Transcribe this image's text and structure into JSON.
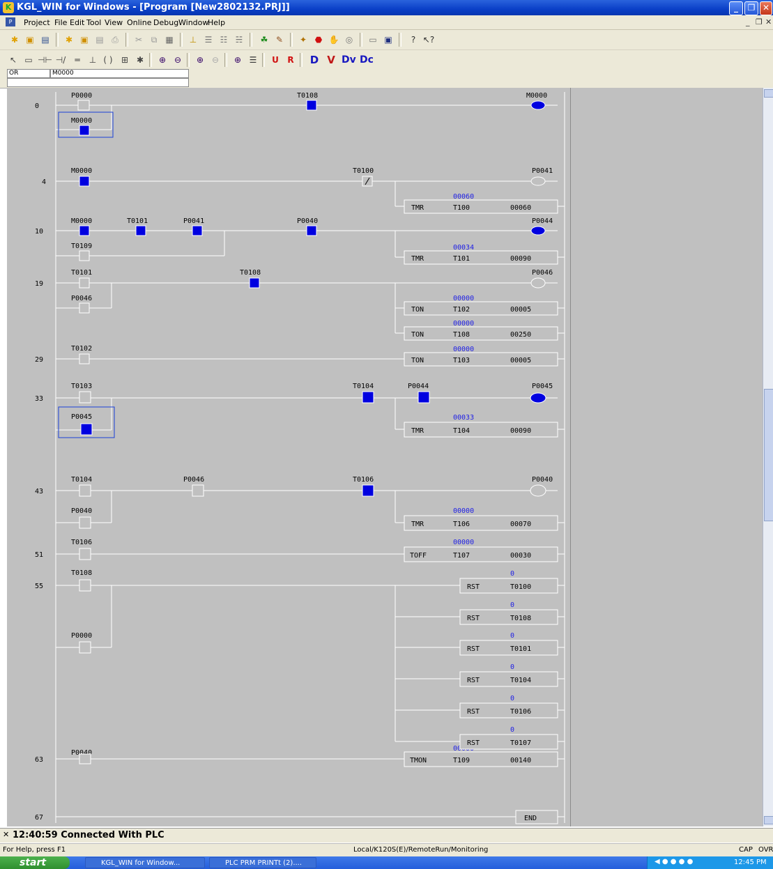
{
  "window": {
    "title": "KGL_WIN for Windows - [Program [New2802132.PRJ]]"
  },
  "menu": [
    "Project",
    "File",
    "Edit",
    "Tool",
    "View",
    "Online",
    "Debug",
    "Window",
    "Help"
  ],
  "input": {
    "mode": "OR",
    "operand": "M0000"
  },
  "ladder": {
    "steps": [
      "0",
      "4",
      "10",
      "19",
      "29",
      "33",
      "43",
      "51",
      "55",
      "63",
      "67"
    ],
    "contacts": [
      "P0000",
      "T0108",
      "M0000",
      "M0000",
      "T0100",
      "M0000",
      "T0101",
      "P0041",
      "P0040",
      "T0109",
      "T0101",
      "T0108",
      "P0046",
      "T0102",
      "T0103",
      "T0104",
      "P0044",
      "P0045",
      "T0104",
      "P0046",
      "T0106",
      "P0040",
      "T0106",
      "T0108",
      "P0000",
      "P0040"
    ],
    "coils": [
      "M0000",
      "P0041",
      "P0044",
      "P0046",
      "P0045",
      "P0040"
    ],
    "function_blocks": [
      {
        "op": "TMR",
        "timer": "T100",
        "preset": "00060",
        "current": "00060"
      },
      {
        "op": "TMR",
        "timer": "T101",
        "preset": "00090",
        "current": "00034"
      },
      {
        "op": "TON",
        "timer": "T102",
        "preset": "00005",
        "current": "00000"
      },
      {
        "op": "TON",
        "timer": "T108",
        "preset": "00250",
        "current": "00000"
      },
      {
        "op": "TON",
        "timer": "T103",
        "preset": "00005",
        "current": "00000"
      },
      {
        "op": "TMR",
        "timer": "T104",
        "preset": "00090",
        "current": "00033"
      },
      {
        "op": "TMR",
        "timer": "T106",
        "preset": "00070",
        "current": "00000"
      },
      {
        "op": "TOFF",
        "timer": "T107",
        "preset": "00030",
        "current": "00000"
      },
      {
        "op": "TMON",
        "timer": "T109",
        "preset": "00140",
        "current": "00000"
      }
    ],
    "resets": [
      {
        "op": "RST",
        "target": "T0100",
        "value": "0"
      },
      {
        "op": "RST",
        "target": "T0108",
        "value": "0"
      },
      {
        "op": "RST",
        "target": "T0101",
        "value": "0"
      },
      {
        "op": "RST",
        "target": "T0104",
        "value": "0"
      },
      {
        "op": "RST",
        "target": "T0106",
        "value": "0"
      },
      {
        "op": "RST",
        "target": "T0107",
        "value": "0"
      }
    ],
    "end_label": "END"
  },
  "message": "12:40:59 Connected With PLC",
  "statusbar": {
    "help": "For Help, press F1",
    "connection": "Local/K120S(E)/RemoteRun/Monitoring",
    "cap": "CAP",
    "ovr": "OVR"
  },
  "taskbar": {
    "start": "start",
    "items": [
      "KGL_WIN for Window...",
      "PLC PRM PRINTt (2)...."
    ],
    "clock": "12:45 PM"
  },
  "colors": {
    "active": "#0000e0",
    "ladder_bg": "#c0c0c0",
    "titlebar": "#0a3fc7"
  }
}
